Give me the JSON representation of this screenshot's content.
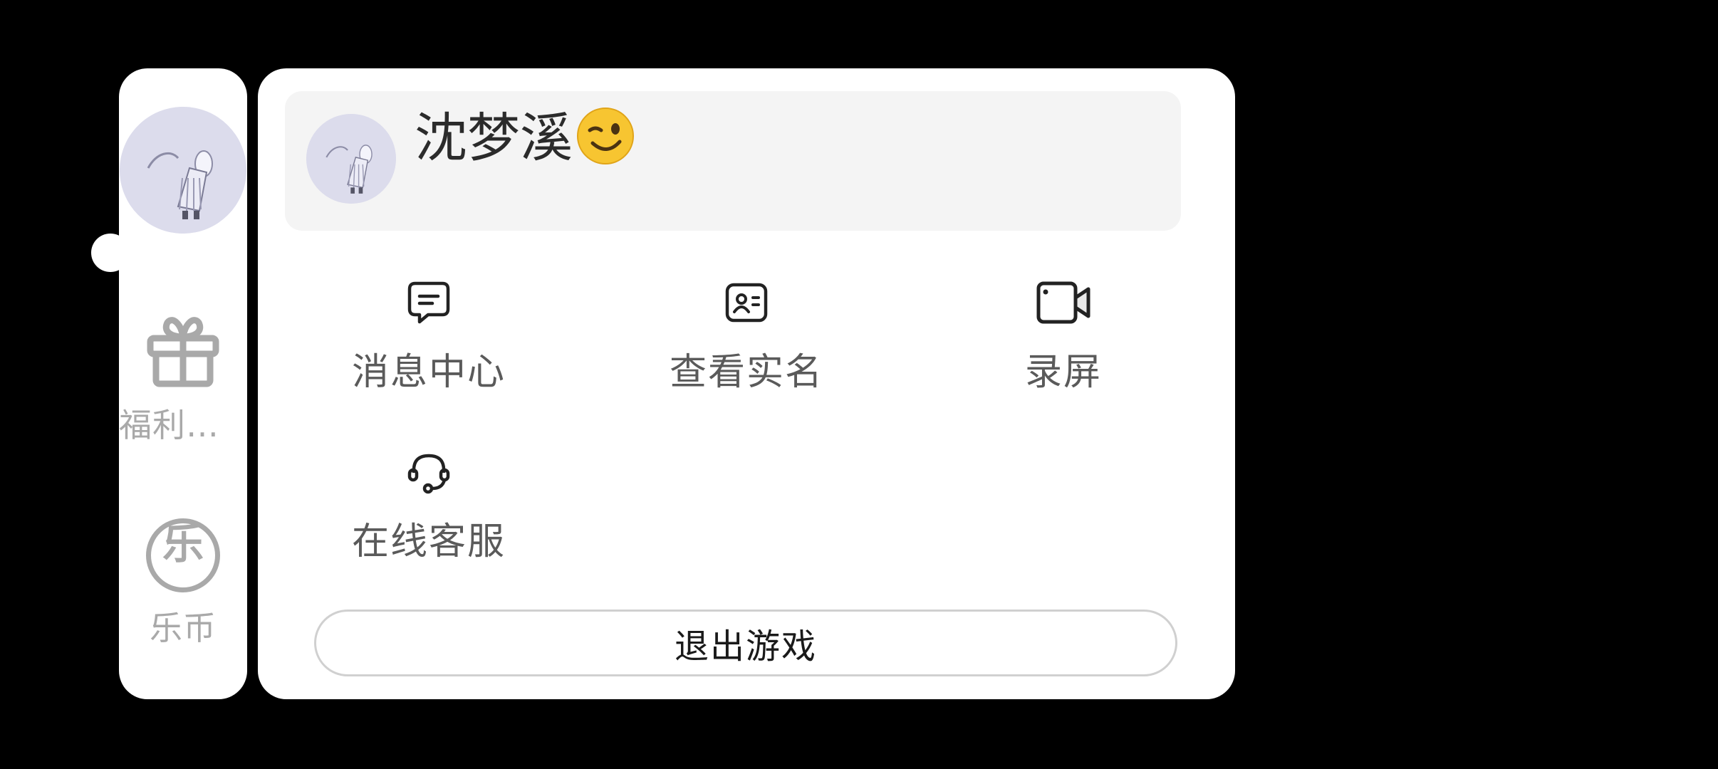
{
  "sidebar": {
    "avatar_icon": "character-avatar",
    "items": [
      {
        "label": "福利礼...",
        "icon": "gift-icon"
      },
      {
        "label": "乐币",
        "icon": "coin-icon",
        "badge_glyph": "乐"
      }
    ]
  },
  "profile": {
    "name": "沈梦溪",
    "emoji_icon": "wink-emoji-icon",
    "avatar_icon": "character-avatar"
  },
  "menu": {
    "items": [
      {
        "label": "消息中心",
        "icon": "message-icon"
      },
      {
        "label": "查看实名",
        "icon": "id-card-icon"
      },
      {
        "label": "录屏",
        "icon": "video-camera-icon"
      },
      {
        "label": "在线客服",
        "icon": "headset-icon"
      }
    ]
  },
  "exit_button": {
    "label": "退出游戏"
  },
  "colors": {
    "background": "#000000",
    "panel": "#ffffff",
    "card": "#f4f4f4",
    "avatar_bg": "#dcdcec",
    "muted_text": "#a9a9a9",
    "menu_text": "#5a5a5a"
  }
}
